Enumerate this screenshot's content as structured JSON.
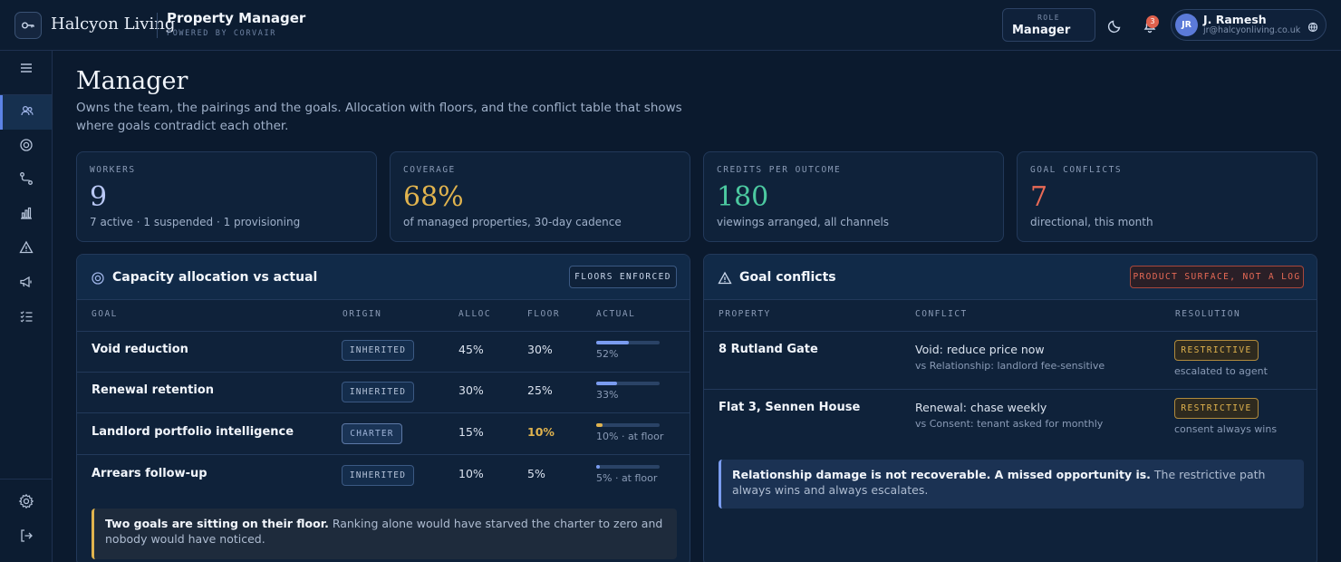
{
  "brand": {
    "name": "Halcyon Living",
    "app_title": "Property Manager",
    "app_sub": "POWERED BY CORVAIR"
  },
  "header": {
    "role_label": "ROLE",
    "role_value": "Manager",
    "notification_count": "3",
    "user": {
      "initials": "JR",
      "name": "J. Ramesh",
      "email": "jr@halcyonliving.co.uk"
    }
  },
  "sidebar": {
    "items": [
      "menu-icon",
      "team-icon",
      "target-icon",
      "route-icon",
      "bar-chart-icon",
      "warning-icon",
      "megaphone-icon",
      "checklist-icon"
    ],
    "active": "team-icon",
    "footer": [
      "gear-icon",
      "logout-icon"
    ]
  },
  "page": {
    "title": "Manager",
    "description": "Owns the team, the pairings and the goals. Allocation with floors, and the conflict table that shows where goals contradict each other."
  },
  "stats": [
    {
      "label": "WORKERS",
      "value": "9",
      "note": "7 active · 1 suspended · 1 provisioning",
      "color": "#b9c8f5"
    },
    {
      "label": "COVERAGE",
      "value": "68%",
      "note": "of managed properties, 30-day cadence",
      "color": "#e0b34e"
    },
    {
      "label": "CREDITS PER OUTCOME",
      "value": "180",
      "note": "viewings arranged, all channels",
      "color": "#4cc9a0"
    },
    {
      "label": "GOAL CONFLICTS",
      "value": "7",
      "note": "directional, this month",
      "color": "#e86a56"
    }
  ],
  "allocation": {
    "title": "Capacity allocation vs actual",
    "badge": "FLOORS ENFORCED",
    "columns": [
      "GOAL",
      "ORIGIN",
      "ALLOC",
      "FLOOR",
      "ACTUAL"
    ],
    "rows": [
      {
        "goal": "Void reduction",
        "origin": "INHERITED",
        "alloc": "45%",
        "floor": "30%",
        "actual": 0.52,
        "actual_label": "52%"
      },
      {
        "goal": "Renewal retention",
        "origin": "INHERITED",
        "alloc": "30%",
        "floor": "25%",
        "actual": 0.33,
        "actual_label": "33%"
      },
      {
        "goal": "Landlord portfolio intelligence",
        "origin": "CHARTER",
        "alloc": "15%",
        "floor": "10%",
        "actual": 0.1,
        "actual_label": "10% · at floor"
      },
      {
        "goal": "Arrears follow-up",
        "origin": "INHERITED",
        "alloc": "10%",
        "floor": "5%",
        "actual": 0.05,
        "actual_label": "5% · at floor"
      }
    ],
    "callout_bold": "Two goals are sitting on their floor.",
    "callout_text": " Ranking alone would have starved the charter to zero and nobody would have noticed."
  },
  "conflicts": {
    "title": "Goal conflicts",
    "badge": "PRODUCT SURFACE, NOT A LOG",
    "columns": [
      "PROPERTY",
      "CONFLICT",
      "RESOLUTION"
    ],
    "rows": [
      {
        "property": "8 Rutland Gate",
        "conflict": "Void: reduce price now",
        "versus": "vs Relationship: landlord fee-sensitive",
        "resolution": "RESTRICTIVE",
        "resolution_note": "escalated to agent"
      },
      {
        "property": "Flat 3, Sennen House",
        "conflict": "Renewal: chase weekly",
        "versus": "vs Consent: tenant asked for monthly",
        "resolution": "RESTRICTIVE",
        "resolution_note": "consent always wins"
      }
    ],
    "callout_bold": "Relationship damage is not recoverable. A missed opportunity is.",
    "callout_text": " The restrictive path always wins and always escalates."
  },
  "colors": {
    "accent": "#5c83e6",
    "amber": "#e0b34e",
    "red": "#e86a56",
    "green": "#4cc9a0"
  }
}
